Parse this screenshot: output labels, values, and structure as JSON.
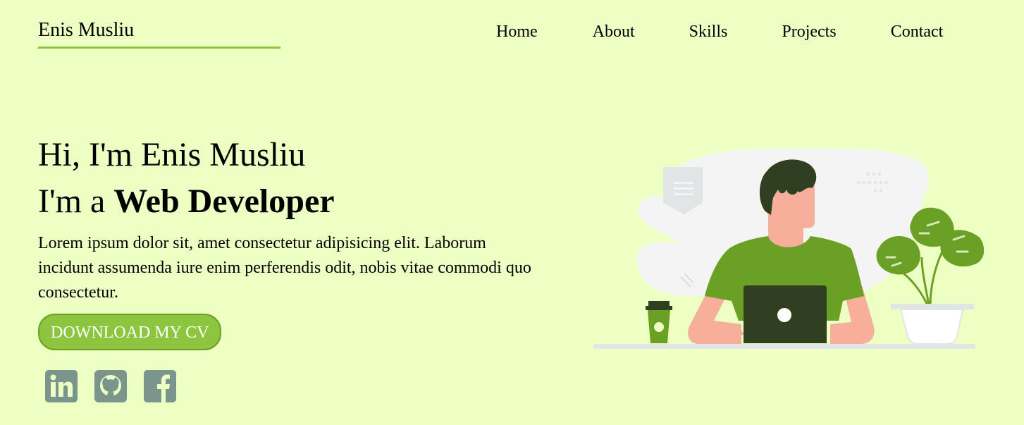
{
  "brand": {
    "name": "Enis Musliu"
  },
  "nav": {
    "items": [
      {
        "label": "Home"
      },
      {
        "label": "About"
      },
      {
        "label": "Skills"
      },
      {
        "label": "Projects"
      },
      {
        "label": "Contact"
      }
    ]
  },
  "hero": {
    "greeting": "Hi, I'm Enis Musliu",
    "role_prefix": "I'm a ",
    "role": "Web Developer",
    "description": "Lorem ipsum dolor sit, amet consectetur adipisicing elit. Laborum incidunt assumenda iure enim perferendis odit, nobis vitae commodi quo consectetur.",
    "cv_button": "DOWNLOAD MY CV"
  },
  "socials": [
    {
      "icon": "linkedin-icon"
    },
    {
      "icon": "github-icon"
    },
    {
      "icon": "facebook-icon"
    }
  ],
  "colors": {
    "background": "#eeffc4",
    "accent": "#8cc63f",
    "icon": "#7a968c",
    "shirt": "#6aa024",
    "hair": "#2f3f1f"
  }
}
